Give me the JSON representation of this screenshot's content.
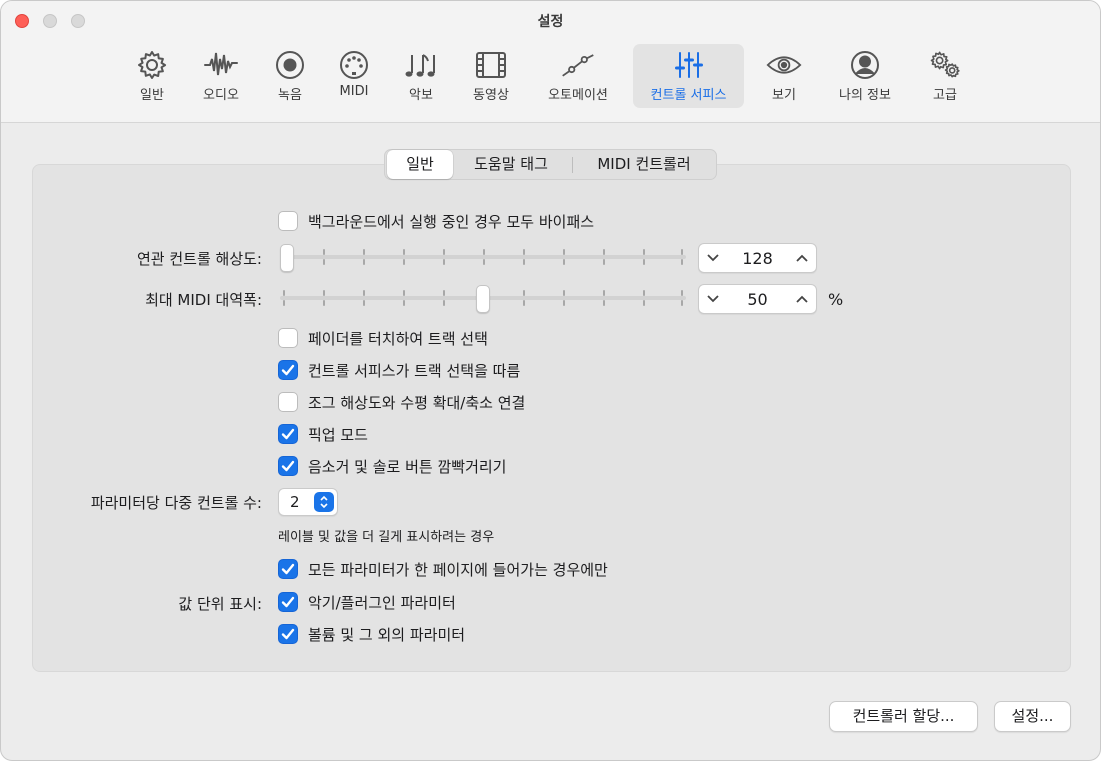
{
  "window": {
    "title": "설정"
  },
  "toolbar": {
    "items": [
      {
        "label": "일반",
        "icon": "gear-icon"
      },
      {
        "label": "오디오",
        "icon": "waveform-icon"
      },
      {
        "label": "녹음",
        "icon": "record-icon"
      },
      {
        "label": "MIDI",
        "icon": "midi-port-icon"
      },
      {
        "label": "악보",
        "icon": "music-notes-icon"
      },
      {
        "label": "동영상",
        "icon": "film-icon"
      },
      {
        "label": "오토메이션",
        "icon": "automation-icon"
      },
      {
        "label": "컨트롤 서피스",
        "icon": "sliders-icon",
        "active": true
      },
      {
        "label": "보기",
        "icon": "eye-icon"
      },
      {
        "label": "나의 정보",
        "icon": "person-icon"
      },
      {
        "label": "고급",
        "icon": "gears-icon"
      }
    ],
    "accent_color": "#1a6ee6"
  },
  "tabs": {
    "items": [
      "일반",
      "도움말 태그",
      "MIDI 컨트롤러"
    ],
    "selected": 0
  },
  "settings": {
    "bypass_label": "백그라운드에서 실행 중인 경우 모두 바이패스",
    "bypass_checked": false,
    "resolution": {
      "label": "연관 컨트롤 해상도:",
      "value": "128",
      "slider_fraction": 0.0
    },
    "bandwidth": {
      "label": "최대 MIDI 대역폭:",
      "value": "50",
      "unit": "%",
      "slider_fraction": 0.5
    },
    "checkboxes": [
      {
        "label": "페이더를 터치하여 트랙 선택",
        "checked": false
      },
      {
        "label": "컨트롤 서피스가 트랙 선택을 따름",
        "checked": true
      },
      {
        "label": "조그 해상도와 수평 확대/축소 연결",
        "checked": false
      },
      {
        "label": "픽업 모드",
        "checked": true
      },
      {
        "label": "음소거 및 솔로 버튼 깜빡거리기",
        "checked": true
      }
    ],
    "multi_controls": {
      "label": "파라미터당 다중 컨트롤 수:",
      "value": "2",
      "hint": "레이블 및 값을 더 길게 표시하려는 경우"
    },
    "fit_page_label": "모든 파라미터가 한 페이지에 들어가는 경우에만",
    "fit_page_checked": true,
    "value_units": {
      "label": "값 단위 표시:",
      "options": [
        {
          "label": "악기/플러그인 파라미터",
          "checked": true
        },
        {
          "label": "볼륨 및 그 외의 파라미터",
          "checked": true
        }
      ]
    }
  },
  "buttons": {
    "controller_assign": "컨트롤러 할당...",
    "setup": "설정..."
  }
}
